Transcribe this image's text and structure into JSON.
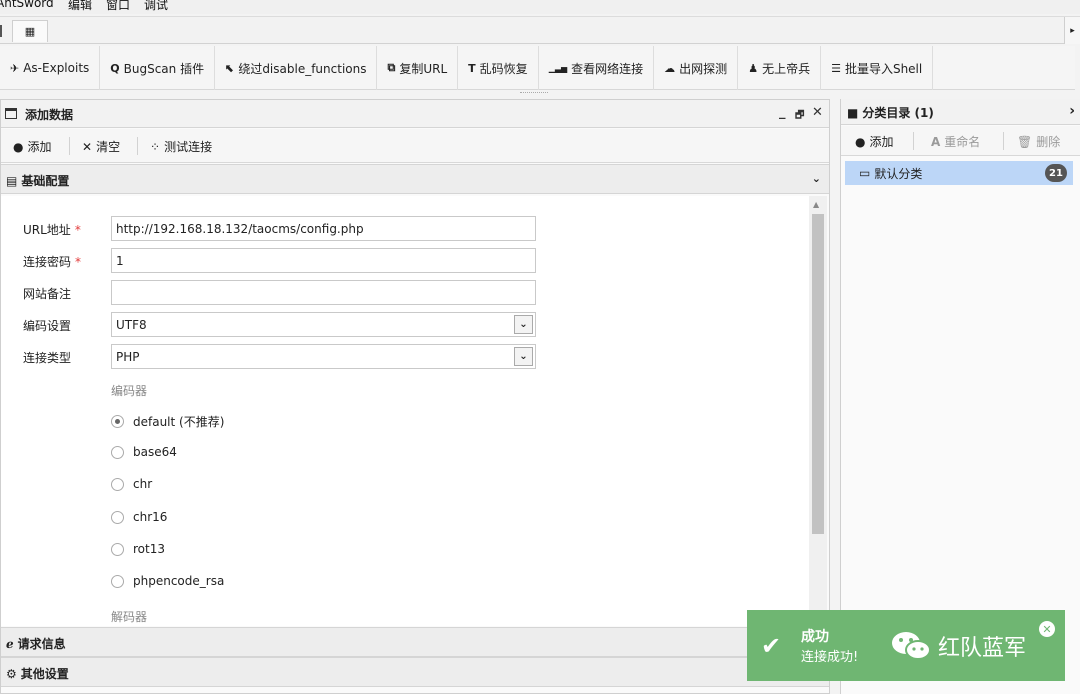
{
  "menubar": {
    "app": "AntSword",
    "items": [
      "编辑",
      "窗口",
      "调试"
    ]
  },
  "tabstrip": {
    "tab_icon": "grid-icon",
    "scroll_arrow": "▸"
  },
  "toolbar": {
    "buttons": [
      {
        "icon": "send-icon",
        "glyph": "✈",
        "label": "As-Exploits"
      },
      {
        "icon": "search-icon",
        "glyph": "Q",
        "label": "BugScan 插件"
      },
      {
        "icon": "cursor-icon",
        "glyph": "⬉",
        "label": "绕过disable_functions"
      },
      {
        "icon": "copy-icon",
        "glyph": "⧉",
        "label": "复制URL"
      },
      {
        "icon": "text-icon",
        "glyph": "T",
        "label": "乱码恢复"
      },
      {
        "icon": "signal-icon",
        "glyph": "▁▃▅",
        "label": "查看网络连接"
      },
      {
        "icon": "cloud-icon",
        "glyph": "☁",
        "label": "出网探测"
      },
      {
        "icon": "chess-icon",
        "glyph": "♟",
        "label": "无上帝兵"
      },
      {
        "icon": "list-icon",
        "glyph": "☰",
        "label": "批量导入Shell"
      }
    ]
  },
  "left_panel": {
    "title": "添加数据",
    "controls": [
      "_",
      "🗗",
      "✕"
    ],
    "actions": {
      "add": "添加",
      "clear": "清空",
      "test": "测试连接"
    },
    "section_basic": "基础配置",
    "section_request": "请求信息",
    "section_other": "其他设置",
    "form": {
      "url_label": "URL地址",
      "url_value": "http://192.168.18.132/taocms/config.php",
      "password_label": "连接密码",
      "password_value": "1",
      "note_label": "网站备注",
      "note_value": "",
      "encoding_label": "编码设置",
      "encoding_value": "UTF8",
      "type_label": "连接类型",
      "type_value": "PHP",
      "required_mark": "*",
      "encoder_title": "编码器",
      "encoders": [
        "default (不推荐)",
        "base64",
        "chr",
        "chr16",
        "rot13",
        "phpencode_rsa"
      ],
      "encoder_selected": 0,
      "decoder_title": "解码器"
    }
  },
  "right_panel": {
    "title": "分类目录 (1)",
    "actions": {
      "add": "添加",
      "rename": "重命名",
      "delete": "删除"
    },
    "items": [
      {
        "label": "默认分类",
        "count": "21"
      }
    ]
  },
  "toast": {
    "title": "成功",
    "message": "连接成功!"
  },
  "watermark": {
    "text": "红队蓝军"
  },
  "colors": {
    "toast_bg": "#6fb672",
    "selected_bg": "#bcd6f7",
    "required": "#e23b3b"
  }
}
